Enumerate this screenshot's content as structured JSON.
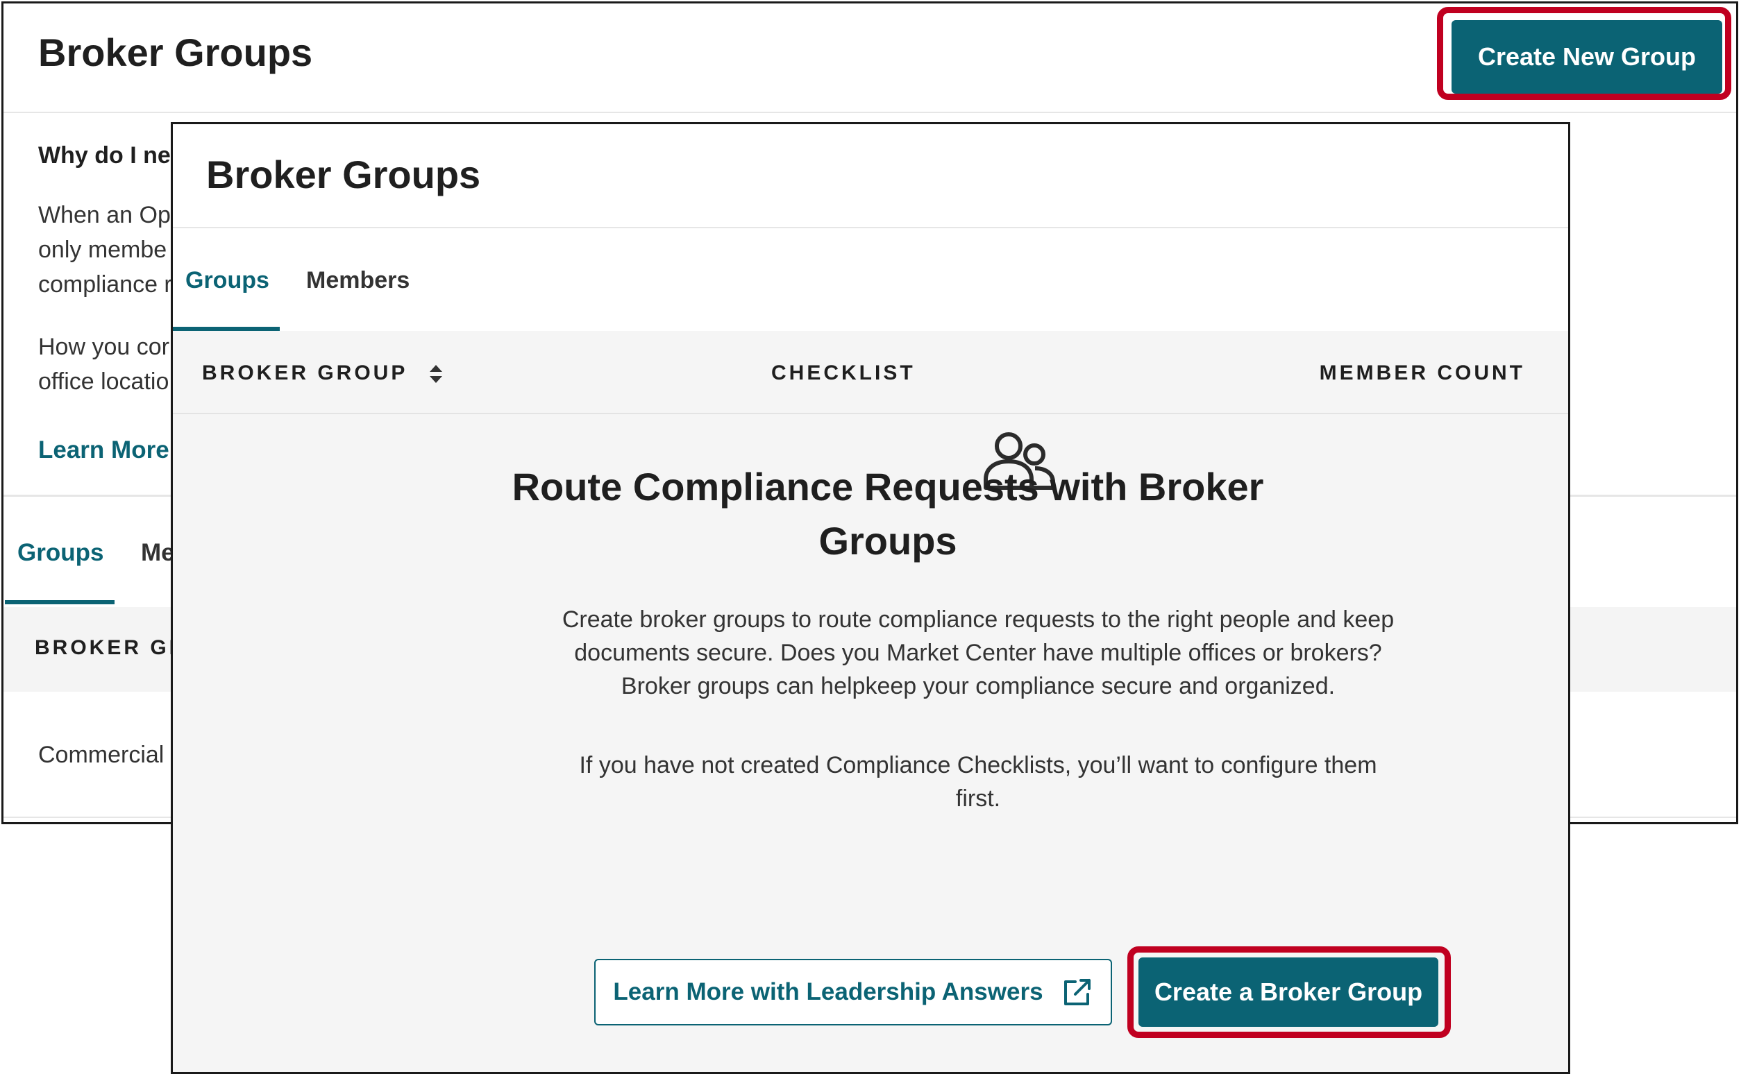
{
  "background": {
    "title": "Broker Groups",
    "create_button": "Create New Group",
    "why_heading": "Why do I ne",
    "paragraph_lines": [
      "When an Op",
      "only membe",
      "compliance r",
      "How you cor",
      "office locatio"
    ],
    "learn_more": "Learn More",
    "tabs": {
      "groups": "Groups",
      "members": "Me"
    },
    "table_header": "BROKER GR",
    "row_text": "Commercial"
  },
  "panel": {
    "title": "Broker Groups",
    "tabs": {
      "groups": "Groups",
      "members": "Members"
    },
    "columns": {
      "broker_group": "BROKER GROUP",
      "checklist": "CHECKLIST",
      "member_count": "MEMBER COUNT"
    },
    "empty_state": {
      "heading_line1": "Route Compliance Requests with Broker",
      "heading_line2": "Groups",
      "description_lines": [
        "Create broker groups to route compliance requests to the right people and keep",
        "documents secure. Does you Market Center have multiple offices or brokers?",
        "Broker groups can helpkeep your compliance secure and organized."
      ],
      "checklist_note_lines": [
        "If you have not created Compliance Checklists, you’ll want to configure them",
        "first."
      ]
    },
    "buttons": {
      "learn_more": "Learn More with Leadership Answers",
      "create": "Create a Broker Group"
    }
  },
  "icons": {
    "empty_state": "users-group-icon",
    "sort": "sort-icon",
    "external_link": "external-link-icon"
  },
  "colors": {
    "primary": "#0b6374",
    "highlight": "#c00020",
    "table_header_bg": "#f5f5f5"
  }
}
